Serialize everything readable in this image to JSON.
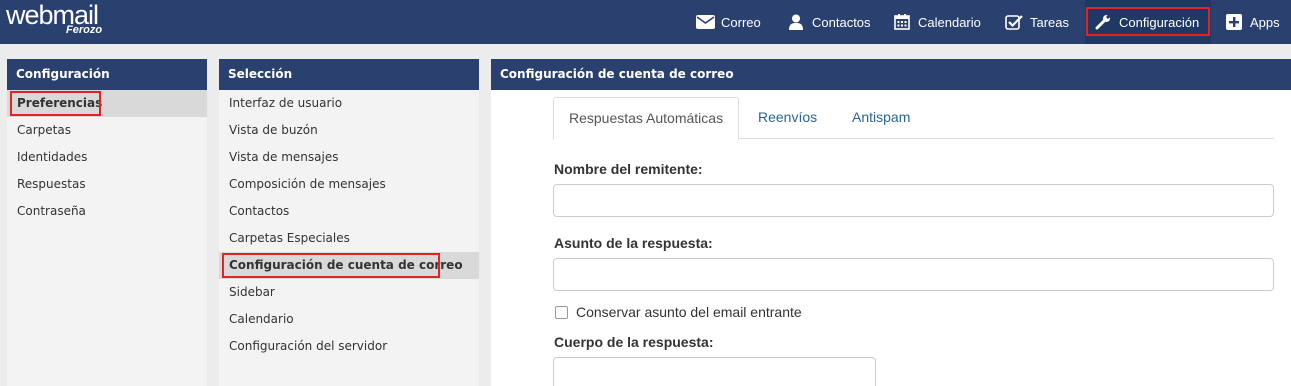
{
  "brand": {
    "main": "webmail",
    "sub": "Ferozo"
  },
  "nav": [
    {
      "label": "Correo",
      "icon": "envelope-icon"
    },
    {
      "label": "Contactos",
      "icon": "user-icon"
    },
    {
      "label": "Calendario",
      "icon": "calendar-icon"
    },
    {
      "label": "Tareas",
      "icon": "checkbox-icon"
    },
    {
      "label": "Configuración",
      "icon": "wrench-icon",
      "active": true
    },
    {
      "label": "Apps",
      "icon": "plus-square-icon"
    }
  ],
  "config_panel": {
    "title": "Configuración",
    "items": [
      {
        "label": "Preferencias",
        "selected": true
      },
      {
        "label": "Carpetas"
      },
      {
        "label": "Identidades"
      },
      {
        "label": "Respuestas"
      },
      {
        "label": "Contraseña"
      }
    ]
  },
  "selection_panel": {
    "title": "Selección",
    "items": [
      {
        "label": "Interfaz de usuario"
      },
      {
        "label": "Vista de buzón"
      },
      {
        "label": "Vista de mensajes"
      },
      {
        "label": "Composición de mensajes"
      },
      {
        "label": "Contactos"
      },
      {
        "label": "Carpetas Especiales"
      },
      {
        "label": "Configuración de cuenta de correo",
        "selected": true
      },
      {
        "label": "Sidebar"
      },
      {
        "label": "Calendario"
      },
      {
        "label": "Configuración del servidor"
      }
    ]
  },
  "main_panel": {
    "title": "Configuración de cuenta de correo",
    "tabs": [
      {
        "label": "Respuestas Automáticas",
        "active": true
      },
      {
        "label": "Reenvíos"
      },
      {
        "label": "Antispam"
      }
    ],
    "form": {
      "sender_label": "Nombre del remitente:",
      "sender_value": "",
      "subject_label": "Asunto de la respuesta:",
      "subject_value": "",
      "keep_subject_label": "Conservar asunto del email entrante",
      "keep_subject_checked": false,
      "body_label": "Cuerpo de la respuesta:"
    }
  },
  "colors": {
    "header": "#2a4170",
    "highlight": "#e02424",
    "link": "#2a6496"
  }
}
